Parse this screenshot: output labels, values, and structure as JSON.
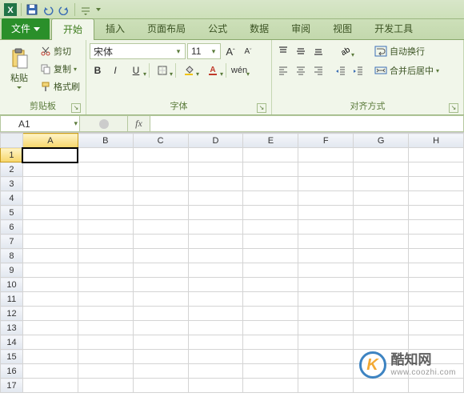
{
  "tabs": {
    "file": "文件",
    "home": "开始",
    "insert": "插入",
    "layout": "页面布局",
    "formulas": "公式",
    "data": "数据",
    "review": "审阅",
    "view": "视图",
    "dev": "开发工具"
  },
  "ribbon": {
    "clipboard": {
      "paste": "粘贴",
      "cut": "剪切",
      "copy": "复制",
      "format_painter": "格式刷",
      "label": "剪贴板"
    },
    "font": {
      "name": "宋体",
      "size": "11",
      "label": "字体"
    },
    "align": {
      "wrap": "自动换行",
      "merge": "合并后居中",
      "label": "对齐方式"
    }
  },
  "namebox": "A1",
  "columns": [
    "A",
    "B",
    "C",
    "D",
    "E",
    "F",
    "G",
    "H"
  ],
  "rows": [
    "1",
    "2",
    "3",
    "4",
    "5",
    "6",
    "7",
    "8",
    "9",
    "10",
    "11",
    "12",
    "13",
    "14",
    "15",
    "16",
    "17"
  ],
  "watermark": {
    "brand": "酷知网",
    "url": "www.coozhi.com"
  }
}
